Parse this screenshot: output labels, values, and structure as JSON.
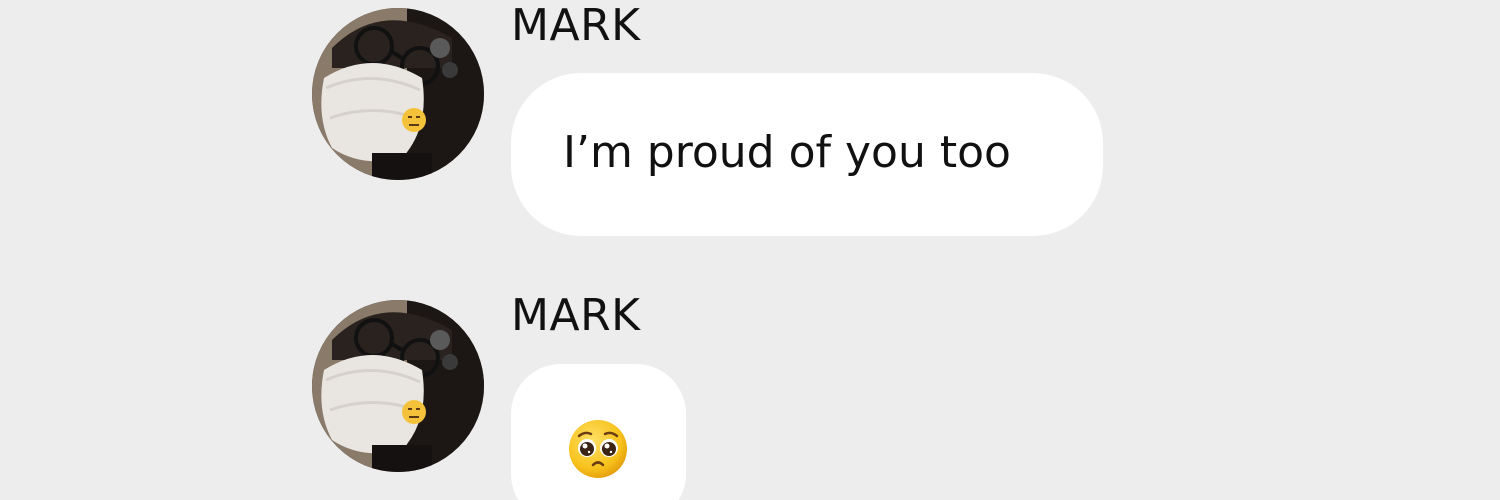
{
  "messages": [
    {
      "sender": "MARK",
      "text": "I’m proud of you too",
      "avatar": "masked-selfie-avatar"
    },
    {
      "sender": "MARK",
      "emoji": "pleading-face",
      "avatar": "masked-selfie-avatar"
    }
  ],
  "colors": {
    "background": "#ededed",
    "bubble": "#ffffff",
    "text": "#111111"
  }
}
